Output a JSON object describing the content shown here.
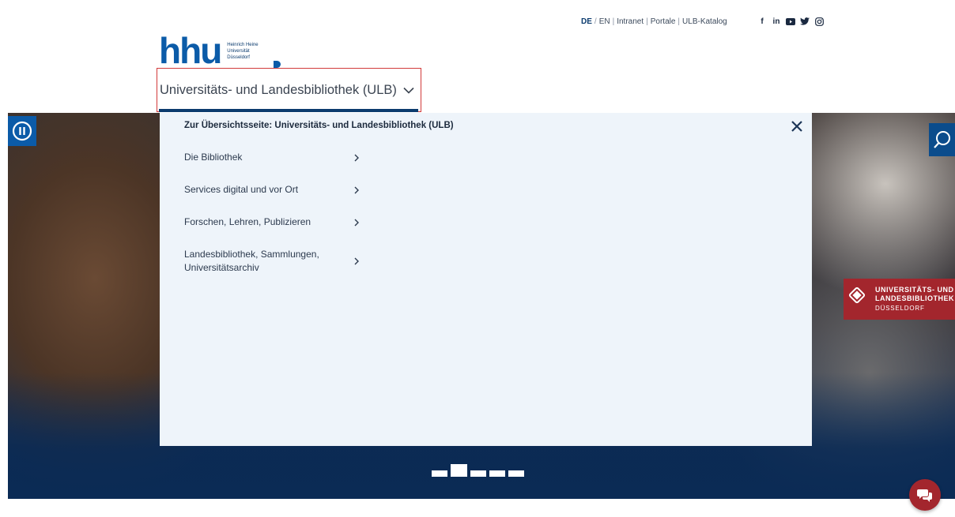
{
  "header": {
    "meta_links": [
      {
        "label": "DE",
        "active": true
      },
      {
        "label": "EN"
      },
      {
        "label": "Intranet"
      },
      {
        "label": "Portale"
      },
      {
        "label": "ULB-Katalog"
      }
    ],
    "lang_separator": "/",
    "link_separator": "|",
    "social_icons": [
      "facebook-icon",
      "linkedin-icon",
      "youtube-icon",
      "twitter-icon",
      "instagram-icon"
    ],
    "logo": {
      "mark": "hhu",
      "line1": "Heinrich Heine",
      "line2": "Universität",
      "line3": "Düsseldorf"
    },
    "library_selector": "Universitäts- und Landesbibliothek (ULB)"
  },
  "menu": {
    "overview_link": "Zur Übersichtsseite: Universitäts- und Landesbibliothek (ULB)",
    "items": [
      {
        "label": "Die Bibliothek"
      },
      {
        "label": "Services digital und vor Ort"
      },
      {
        "label": "Forschen, Lehren, Publizieren"
      },
      {
        "label": "Landesbibliothek, Sammlungen, Universitätsarchiv"
      }
    ]
  },
  "hero": {
    "badge": {
      "line1": "UNIVERSITÄTS- UND",
      "line2": "LANDESBIBLIOTHEK",
      "line3": "DÜSSELDORF"
    },
    "slides_total": 5,
    "active_slide": 2
  },
  "colors": {
    "brand_blue": "#0b5ba8",
    "dark_blue": "#0b3b6e",
    "ulb_red": "#a3262d",
    "menu_bg": "#eef4fa",
    "selector_outline": "#d23a3a"
  }
}
